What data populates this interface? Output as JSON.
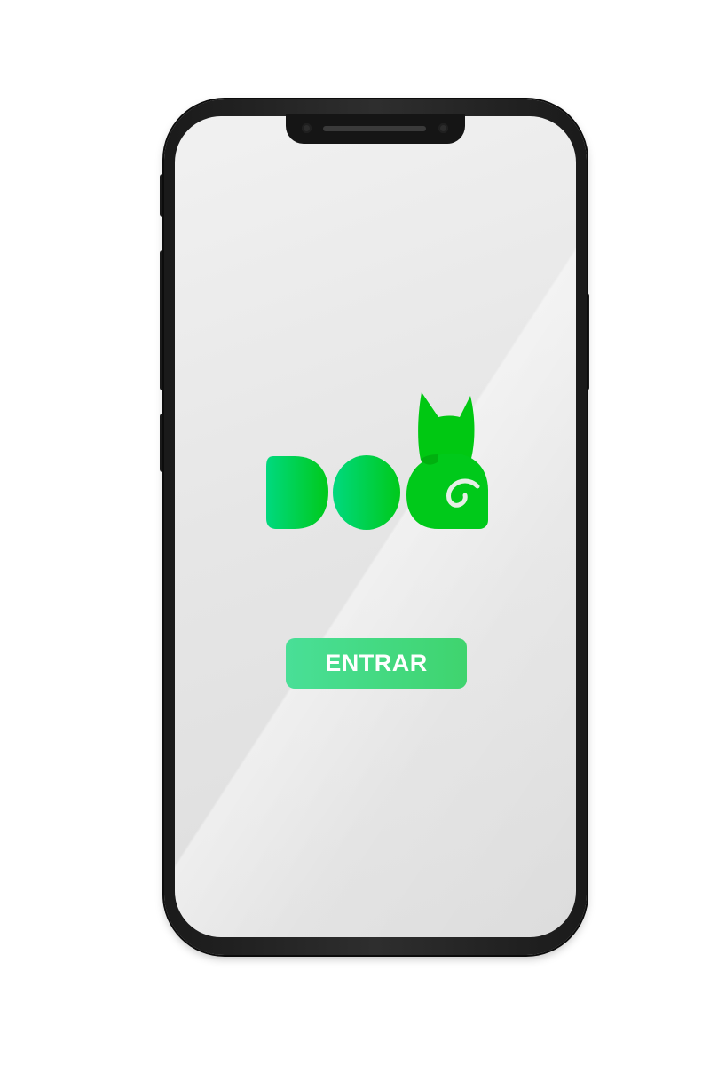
{
  "app": {
    "logo_text": "DOG",
    "enter_label": "ENTRAR"
  },
  "colors": {
    "logo_green_start": "#00d882",
    "logo_green_end": "#00c912",
    "button_green_start": "#49df97",
    "button_green_end": "#3fd46e",
    "screen_bg": "#e8e8e8",
    "phone_frame": "#1f1f1f"
  },
  "icons": {
    "logo": "dog-logo-icon"
  }
}
